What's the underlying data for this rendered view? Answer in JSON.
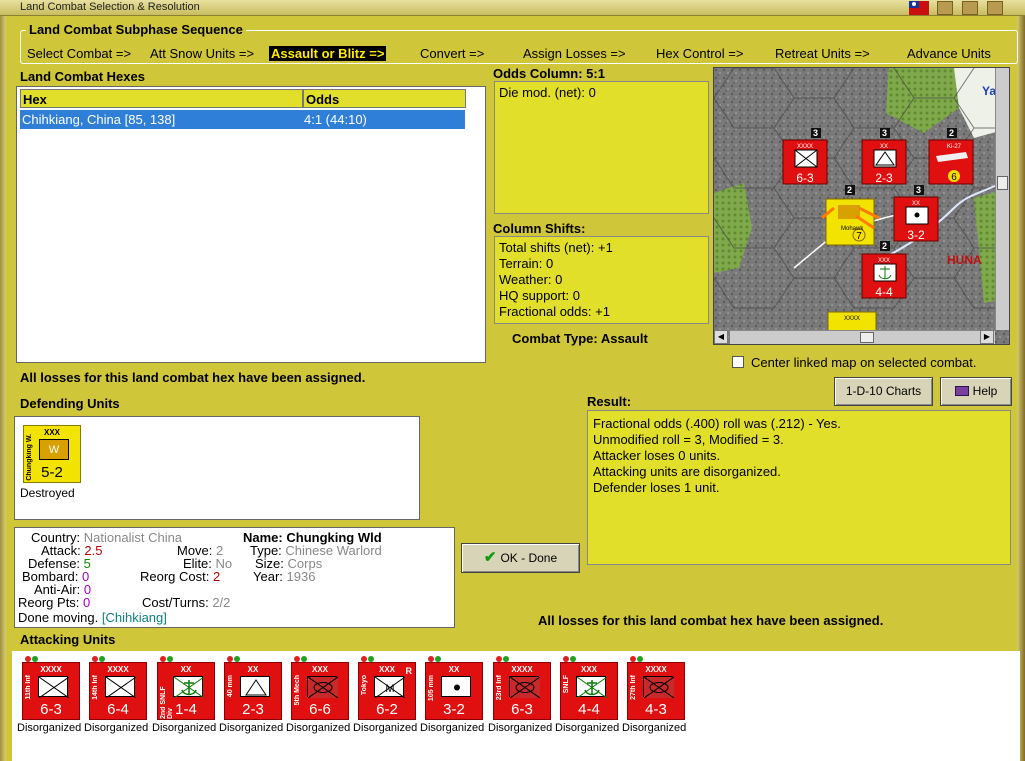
{
  "window": {
    "title": "Land Combat Selection & Resolution"
  },
  "sequence": {
    "label": "Land Combat Subphase Sequence",
    "items": [
      "Select Combat =>",
      "Att Snow Units =>",
      "Assault or Blitz =>",
      "Convert =>",
      "Assign Losses =>",
      "Hex Control =>",
      "Retreat Units =>",
      "Advance Units"
    ],
    "active_index": 2
  },
  "hexes": {
    "label": "Land Combat Hexes",
    "columns": [
      "Hex",
      "Odds"
    ],
    "rows": [
      {
        "hex": "Chihkiang, China [85, 138]",
        "odds": "4:1 (44:10)"
      }
    ]
  },
  "odds": {
    "label": "Odds Column: 5:1",
    "die_mod": "Die mod. (net): 0"
  },
  "shifts": {
    "label": "Column Shifts:",
    "lines": [
      "Total shifts (net): +1",
      "Terrain: 0",
      "Weather: 0",
      "HQ support: 0",
      "Fractional odds: +1"
    ]
  },
  "combat_type": "Combat Type:  Assault",
  "center_map": "Center linked map on selected combat.",
  "buttons": {
    "charts": "1-D-10 Charts",
    "help": "Help",
    "ok": "OK - Done"
  },
  "losses_msg": "All losses for this land combat hex have been assigned.",
  "result": {
    "label": "Result:",
    "lines": [
      "Fractional odds (.400) roll was (.212)  - Yes.",
      "Unmodified roll = 3, Modified = 3.",
      "Attacker loses 0 units.",
      "Attacking units are disorganized.",
      "Defender loses 1 unit."
    ]
  },
  "defending": {
    "label": "Defending Units",
    "unit": {
      "size": "XXX",
      "name": "Chungking W.",
      "symbol": "W",
      "value": "5-2",
      "status": "Destroyed"
    }
  },
  "info": {
    "country_lbl": "Country:",
    "country": "Nationalist China",
    "attack_lbl": "Attack:",
    "attack": "2.5",
    "defense_lbl": "Defense:",
    "defense": "5",
    "bombard_lbl": "Bombard:",
    "bombard": "0",
    "antiair_lbl": "Anti-Air:",
    "antiair": "0",
    "reorgpts_lbl": "Reorg Pts:",
    "reorgpts": "0",
    "move_lbl": "Move:",
    "move": "2",
    "elite_lbl": "Elite:",
    "elite": "No",
    "reorgcost_lbl": "Reorg Cost:",
    "reorgcost": "2",
    "costturns_lbl": "Cost/Turns:",
    "costturns": "2/2",
    "name_lbl": "Name:",
    "name": "Chungking Wld",
    "type_lbl": "Type:",
    "type": "Chinese Warlord",
    "size_lbl": "Size:",
    "size": "Corps",
    "year_lbl": "Year:",
    "year": "1936",
    "done_moving": "Done moving.",
    "done_place": "[Chihkiang]"
  },
  "attacking": {
    "label": "Attacking Units",
    "units": [
      {
        "size": "XXXX",
        "name": "11th Inf",
        "value": "6-3",
        "status": "Disorganized",
        "symbol": "inf"
      },
      {
        "size": "XXXX",
        "name": "14th Inf",
        "value": "6-4",
        "status": "Disorganized",
        "symbol": "inf"
      },
      {
        "size": "XX",
        "name": "2nd SNLF Div",
        "value": "1-4",
        "status": "Disorganized",
        "symbol": "marine"
      },
      {
        "size": "XX",
        "name": "40 mm",
        "value": "2-3",
        "status": "Disorganized",
        "symbol": "aa"
      },
      {
        "size": "XXX",
        "name": "5th Mech",
        "value": "6-6",
        "status": "Disorganized",
        "symbol": "mech"
      },
      {
        "size": "XXX",
        "name": "Tokyo",
        "value": "6-2",
        "status": "Disorganized",
        "symbol": "motor",
        "extra": "R"
      },
      {
        "size": "XX",
        "name": "105 mm",
        "value": "3-2",
        "status": "Disorganized",
        "symbol": "art"
      },
      {
        "size": "XXXX",
        "name": "23rd Inf",
        "value": "6-3",
        "status": "Disorganized",
        "symbol": "mech"
      },
      {
        "size": "XXX",
        "name": "SNLF",
        "value": "4-4",
        "status": "Disorganized",
        "symbol": "marine"
      },
      {
        "size": "XXXX",
        "name": "27th Inf",
        "value": "4-3",
        "status": "Disorganized",
        "symbol": "mech"
      }
    ]
  },
  "map": {
    "labels": [
      "HUNA",
      "Ya"
    ],
    "units": [
      {
        "size": "XXXX",
        "value": "6-3",
        "stack": "3"
      },
      {
        "size": "XX",
        "value": "2-3",
        "stack": "3"
      },
      {
        "size": "",
        "value": "6",
        "stack": "2",
        "air": "Ki-27"
      },
      {
        "size": "",
        "value": "7",
        "stack": "2",
        "air": "Mohawk"
      },
      {
        "size": "XX",
        "value": "3-2",
        "stack": "3"
      },
      {
        "size": "XXX",
        "value": "4-4",
        "stack": "2"
      },
      {
        "size": "XXXX",
        "value": "",
        "stack": ""
      }
    ]
  }
}
